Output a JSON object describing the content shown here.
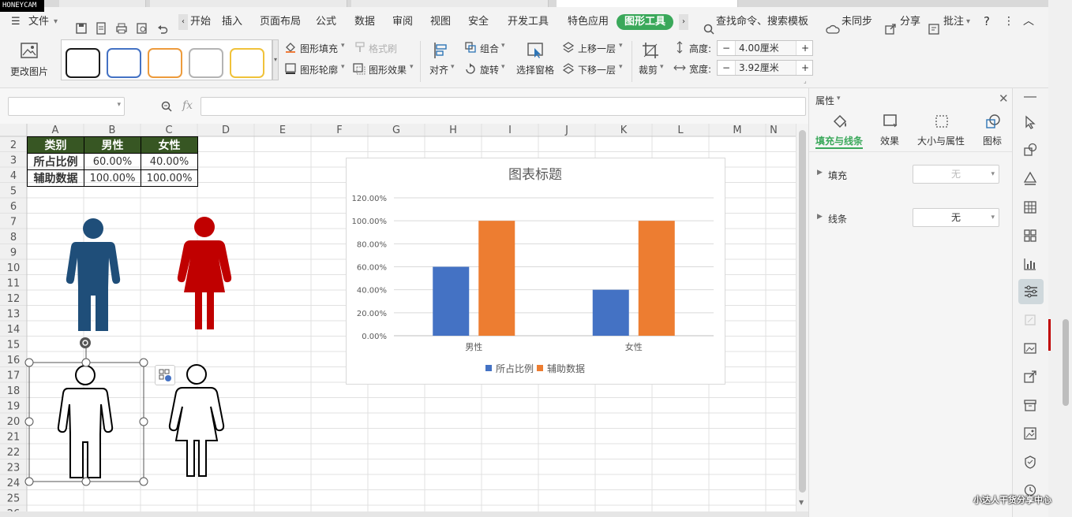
{
  "watermark": "HONEYCAM",
  "menubar": {
    "file_label": "文件",
    "tabs": [
      "开始",
      "插入",
      "页面布局",
      "公式",
      "数据",
      "审阅",
      "视图",
      "安全",
      "开发工具",
      "特色应用",
      "图形工具"
    ],
    "search_label": "查找命令、搜索模板",
    "sync_label": "未同步",
    "share_label": "分享",
    "comment_label": "批注"
  },
  "ribbon": {
    "change_picture": "更改图片",
    "shape_fill": "图形填充",
    "format_brush": "格式刷",
    "shape_outline": "图形轮廓",
    "shape_effect": "图形效果",
    "align": "对齐",
    "group": "组合",
    "rotate": "旋转",
    "selection_pane": "选择窗格",
    "bring_forward": "上移一层",
    "send_backward": "下移一层",
    "crop": "裁剪",
    "height_label": "高度:",
    "height_value": "4.00厘米",
    "width_label": "宽度:",
    "width_value": "3.92厘米",
    "minus": "−",
    "plus": "+",
    "preset_colors": [
      "#1a1a1a",
      "#4472c4",
      "#ed9b3c",
      "#b4b4b4",
      "#f0c23a"
    ]
  },
  "formula": {
    "fx": "fx"
  },
  "sheet": {
    "columns": [
      "A",
      "B",
      "C",
      "D",
      "E",
      "F",
      "G",
      "H",
      "I",
      "J",
      "K",
      "L",
      "M",
      "N"
    ],
    "rows": [
      "2",
      "3",
      "4",
      "5",
      "6",
      "7",
      "8",
      "9",
      "10",
      "11",
      "12",
      "13",
      "14",
      "15",
      "16",
      "17",
      "18",
      "19",
      "20",
      "21",
      "22",
      "23",
      "24",
      "25",
      "26"
    ],
    "table": {
      "header": [
        "类别",
        "男性",
        "女性"
      ],
      "row1": [
        "所占比例",
        "60.00%",
        "40.00%"
      ],
      "row2": [
        "辅助数据",
        "100.00%",
        "100.00%"
      ]
    },
    "header_bg": "#375623"
  },
  "chart_data": {
    "type": "bar",
    "title": "图表标题",
    "categories": [
      "男性",
      "女性"
    ],
    "series": [
      {
        "name": "所占比例",
        "values": [
          0.6,
          0.4
        ],
        "color": "#4472c4"
      },
      {
        "name": "辅助数据",
        "values": [
          1.0,
          1.0
        ],
        "color": "#ed7d31"
      }
    ],
    "ylim": [
      0,
      1.2
    ],
    "yticks": [
      "0.00%",
      "20.00%",
      "40.00%",
      "60.00%",
      "80.00%",
      "100.00%",
      "120.00%"
    ],
    "grid": true,
    "legend": "bottom"
  },
  "figures": {
    "male_color": "#1f4e79",
    "female_color": "#c00000"
  },
  "props": {
    "title": "属性",
    "tabs": [
      "填充与线条",
      "效果",
      "大小与属性",
      "图标"
    ],
    "fill_label": "填充",
    "fill_value": "无",
    "line_label": "线条",
    "line_value": "无",
    "accent": "#3aa85a"
  },
  "footer": {
    "watermark": "小达人干货分享中心"
  }
}
